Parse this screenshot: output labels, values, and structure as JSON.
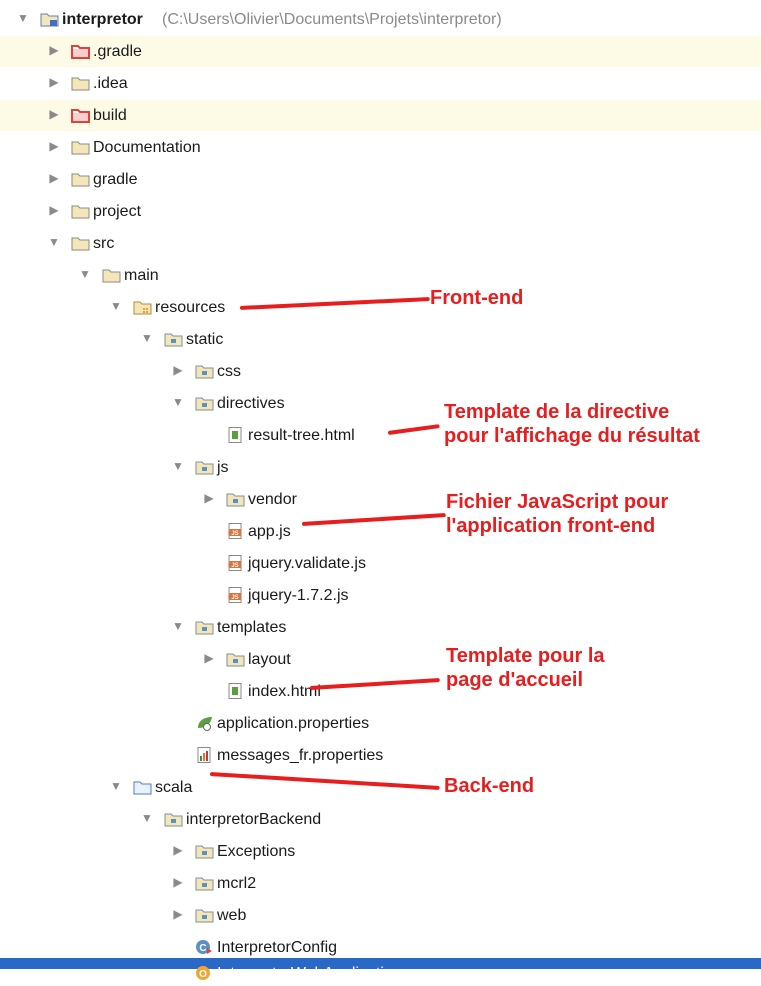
{
  "tree": [
    {
      "label": "interpretor",
      "path": "(C:\\Users\\Olivier\\Documents\\Projets\\interpretor)",
      "icon": "module-folder-icon",
      "arrow": "expanded"
    },
    {
      "label": ".gradle",
      "icon": "excluded-folder-icon",
      "arrow": "collapsed",
      "highlight": true
    },
    {
      "label": ".idea",
      "icon": "folder-icon",
      "arrow": "collapsed"
    },
    {
      "label": "build",
      "icon": "excluded-folder-icon",
      "arrow": "collapsed",
      "highlight": true
    },
    {
      "label": "Documentation",
      "icon": "folder-icon",
      "arrow": "collapsed"
    },
    {
      "label": "gradle",
      "icon": "folder-icon",
      "arrow": "collapsed"
    },
    {
      "label": "project",
      "icon": "folder-icon",
      "arrow": "collapsed"
    },
    {
      "label": "src",
      "icon": "folder-icon",
      "arrow": "expanded"
    },
    {
      "label": "main",
      "icon": "folder-icon",
      "arrow": "expanded"
    },
    {
      "label": "resources",
      "icon": "resources-folder-icon",
      "arrow": "expanded"
    },
    {
      "label": "static",
      "icon": "package-folder-icon",
      "arrow": "expanded"
    },
    {
      "label": "css",
      "icon": "package-folder-icon",
      "arrow": "collapsed"
    },
    {
      "label": "directives",
      "icon": "package-folder-icon",
      "arrow": "expanded"
    },
    {
      "label": "result-tree.html",
      "icon": "html-file-icon",
      "arrow": "none"
    },
    {
      "label": "js",
      "icon": "package-folder-icon",
      "arrow": "expanded"
    },
    {
      "label": "vendor",
      "icon": "package-folder-icon",
      "arrow": "collapsed"
    },
    {
      "label": "app.js",
      "icon": "js-file-icon",
      "arrow": "none"
    },
    {
      "label": "jquery.validate.js",
      "icon": "js-file-icon",
      "arrow": "none"
    },
    {
      "label": "jquery-1.7.2.js",
      "icon": "js-file-icon",
      "arrow": "none"
    },
    {
      "label": "templates",
      "icon": "package-folder-icon",
      "arrow": "expanded"
    },
    {
      "label": "layout",
      "icon": "package-folder-icon",
      "arrow": "collapsed"
    },
    {
      "label": "index.html",
      "icon": "html-file-icon",
      "arrow": "none"
    },
    {
      "label": "application.properties",
      "icon": "spring-properties-icon",
      "arrow": "none"
    },
    {
      "label": "messages_fr.properties",
      "icon": "properties-file-icon",
      "arrow": "none"
    },
    {
      "label": "scala",
      "icon": "source-folder-icon",
      "arrow": "expanded"
    },
    {
      "label": "interpretorBackend",
      "icon": "package-folder-icon",
      "arrow": "expanded"
    },
    {
      "label": "Exceptions",
      "icon": "package-folder-icon",
      "arrow": "collapsed"
    },
    {
      "label": "mcrl2",
      "icon": "package-folder-icon",
      "arrow": "collapsed"
    },
    {
      "label": "web",
      "icon": "package-folder-icon",
      "arrow": "collapsed"
    },
    {
      "label": "InterpretorConfig",
      "icon": "scala-class-icon",
      "arrow": "none"
    },
    {
      "label": "InterpretorWebApplication",
      "icon": "scala-object-icon",
      "arrow": "none",
      "selected": true
    }
  ],
  "annotations": [
    {
      "text": "Front-end"
    },
    {
      "text": "Template de la directive\npour l'affichage du résultat"
    },
    {
      "text": "Fichier JavaScript pour\nl'application front-end"
    },
    {
      "text": "Template pour la\npage d'accueil"
    },
    {
      "text": "Back-end"
    }
  ],
  "colors": {
    "annotation": "#e81d1d",
    "selection": "#2a68c8",
    "highlight_row": "#fdfbe6",
    "folder": "#c9a86a",
    "excluded_folder": "#e0413a"
  }
}
